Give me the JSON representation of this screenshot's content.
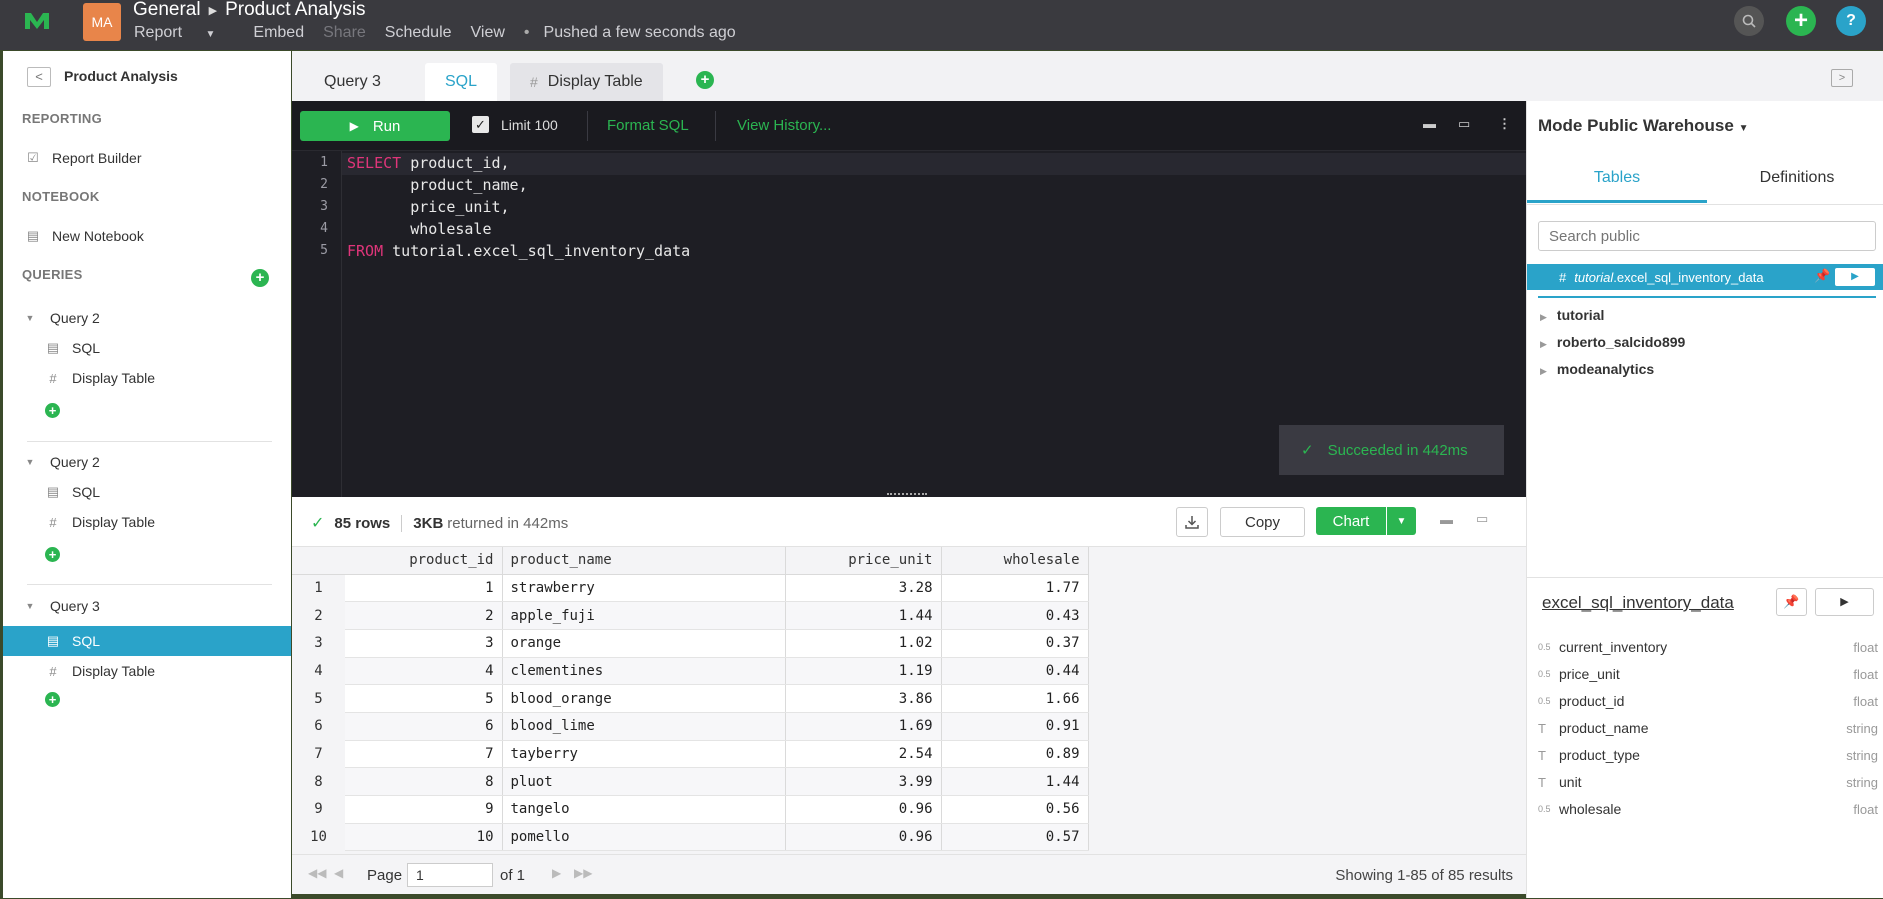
{
  "colors": {
    "accent": "#2aa3c9",
    "green": "#2bb551",
    "avatar": "#e8854a",
    "topbar": "#3a3a3f",
    "editor": "#1e1e24"
  },
  "topbar": {
    "avatar": "MA",
    "breadcrumb": [
      "General",
      "Product Analysis"
    ],
    "menu": {
      "report": "Report",
      "embed": "Embed",
      "share": "Share",
      "schedule": "Schedule",
      "view": "View",
      "status": "Pushed a few seconds ago"
    }
  },
  "sidebar": {
    "title": "Product Analysis",
    "reporting_heading": "REPORTING",
    "report_builder": "Report Builder",
    "notebook_heading": "NOTEBOOK",
    "new_notebook": "New Notebook",
    "queries_heading": "QUERIES",
    "queries": [
      {
        "name": "Query 2",
        "sql": "SQL",
        "display": "Display Table"
      },
      {
        "name": "Query 2",
        "sql": "SQL",
        "display": "Display Table"
      },
      {
        "name": "Query 3",
        "sql": "SQL",
        "display": "Display Table"
      }
    ]
  },
  "tabs": {
    "query": "Query 3",
    "sql": "SQL",
    "display": "Display Table"
  },
  "editor": {
    "run": "Run",
    "limit": "Limit 100",
    "format": "Format SQL",
    "history": "View History...",
    "lines": [
      {
        "n": "1",
        "kw": "SELECT",
        "rest": " product_id,"
      },
      {
        "n": "2",
        "kw": "",
        "rest": "       product_name,"
      },
      {
        "n": "3",
        "kw": "",
        "rest": "       price_unit,"
      },
      {
        "n": "4",
        "kw": "",
        "rest": "       wholesale"
      },
      {
        "n": "5",
        "kw": "FROM",
        "rest": " tutorial.excel_sql_inventory_data"
      }
    ],
    "success": "Succeeded in 442ms"
  },
  "results": {
    "rows_count": "85 rows",
    "size": "3KB",
    "returned": "returned in 442ms",
    "copy": "Copy",
    "chart": "Chart",
    "columns": [
      "product_id",
      "product_name",
      "price_unit",
      "wholesale"
    ],
    "rows": [
      [
        "1",
        "1",
        "strawberry",
        "3.28",
        "1.77"
      ],
      [
        "2",
        "2",
        "apple_fuji",
        "1.44",
        "0.43"
      ],
      [
        "3",
        "3",
        "orange",
        "1.02",
        "0.37"
      ],
      [
        "4",
        "4",
        "clementines",
        "1.19",
        "0.44"
      ],
      [
        "5",
        "5",
        "blood_orange",
        "3.86",
        "1.66"
      ],
      [
        "6",
        "6",
        "blood_lime",
        "1.69",
        "0.91"
      ],
      [
        "7",
        "7",
        "tayberry",
        "2.54",
        "0.89"
      ],
      [
        "8",
        "8",
        "pluot",
        "3.99",
        "1.44"
      ],
      [
        "9",
        "9",
        "tangelo",
        "0.96",
        "0.56"
      ],
      [
        "10",
        "10",
        "pomello",
        "0.96",
        "0.57"
      ]
    ]
  },
  "pager": {
    "page_label": "Page",
    "page_value": "1",
    "of": "of 1",
    "showing": "Showing 1-85 of 85 results"
  },
  "right_panel": {
    "warehouse": "Mode Public Warehouse",
    "tabs": [
      "Tables",
      "Definitions"
    ],
    "search_placeholder": "Search public",
    "pinned_schema": "tutorial",
    "pinned_table": ".excel_sql_inventory_data",
    "schemas": [
      "tutorial",
      "roberto_salcido899",
      "modeanalytics"
    ],
    "detail_title": "excel_sql_inventory_data",
    "columns": [
      {
        "name": "current_inventory",
        "type": "float",
        "icon": "0.5"
      },
      {
        "name": "price_unit",
        "type": "float",
        "icon": "0.5"
      },
      {
        "name": "product_id",
        "type": "float",
        "icon": "0.5"
      },
      {
        "name": "product_name",
        "type": "string",
        "icon": "T"
      },
      {
        "name": "product_type",
        "type": "string",
        "icon": "T"
      },
      {
        "name": "unit",
        "type": "string",
        "icon": "T"
      },
      {
        "name": "wholesale",
        "type": "float",
        "icon": "0.5"
      }
    ]
  }
}
